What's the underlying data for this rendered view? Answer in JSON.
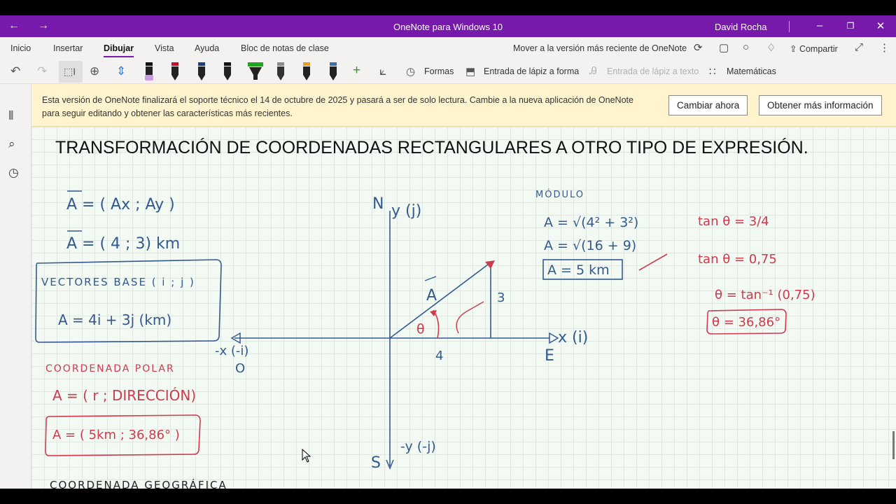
{
  "titlebar": {
    "title": "OneNote para Windows 10",
    "user": "David Rocha"
  },
  "tabs": [
    "Inicio",
    "Insertar",
    "Dibujar",
    "Vista",
    "Ayuda",
    "Bloc de notas de clase"
  ],
  "ribbon_right": {
    "update_link": "Mover a la versión más reciente de OneNote",
    "share": "Compartir"
  },
  "toolbar": {
    "shapes": "Formas",
    "ink_to_shape": "Entrada de lápiz a forma",
    "ink_to_text": "Entrada de lápiz a texto",
    "math": "Matemáticas",
    "pen_colors": [
      "#111111",
      "#c8102e",
      "#1f3f7a",
      "#111111",
      "#1fa51f",
      "#8a8a8a",
      "#e0a020",
      "#222222"
    ]
  },
  "banner": {
    "message": "Esta versión de OneNote finalizará el soporte técnico el 14 de octubre de 2025 y pasará a ser de solo lectura. Cambie a la nueva aplicación de OneNote para seguir editando y obtener las características más recientes.",
    "change_now": "Cambiar ahora",
    "more_info": "Obtener más información"
  },
  "note": {
    "title": "TRANSFORMACIÓN DE COORDENADAS RECTANGULARES A OTRO TIPO DE EXPRESIÓN.",
    "ink": {
      "vec_components": "A = ( Ax ; Ay )",
      "vec_values": "A = ( 4 ; 3) km",
      "base_vectors_title": "VECTORES BASE ( i ; j )",
      "base_vectors_expr": "A = 4i + 3j (km)",
      "polar_title": "COORDENADA POLAR",
      "polar_general": "A = ( r ; DIRECCIÓN)",
      "polar_value": "A = ( 5km ; 36,86° )",
      "geo_title": "COORDENADA GEOGRÁFICA",
      "axis_n": "N",
      "axis_y": "y (j)",
      "axis_x": "x (i)",
      "axis_e": "E",
      "axis_neg_x": "-x (-i)",
      "axis_o": "O",
      "axis_s": "S",
      "axis_neg_y": "-y (-j)",
      "vector_label": "A",
      "side_x": "4",
      "side_y": "3",
      "angle": "θ",
      "modulo_title": "MÓDULO",
      "mod_line1": "A = √(4² + 3²)",
      "mod_line2": "A = √(16 + 9)",
      "mod_result": "A = 5 km",
      "tan1": "tan θ = 3/4",
      "tan2": "tan θ = 0,75",
      "theta_eq": "θ = tan⁻¹ (0,75)",
      "theta_result": "θ = 36,86°"
    }
  }
}
